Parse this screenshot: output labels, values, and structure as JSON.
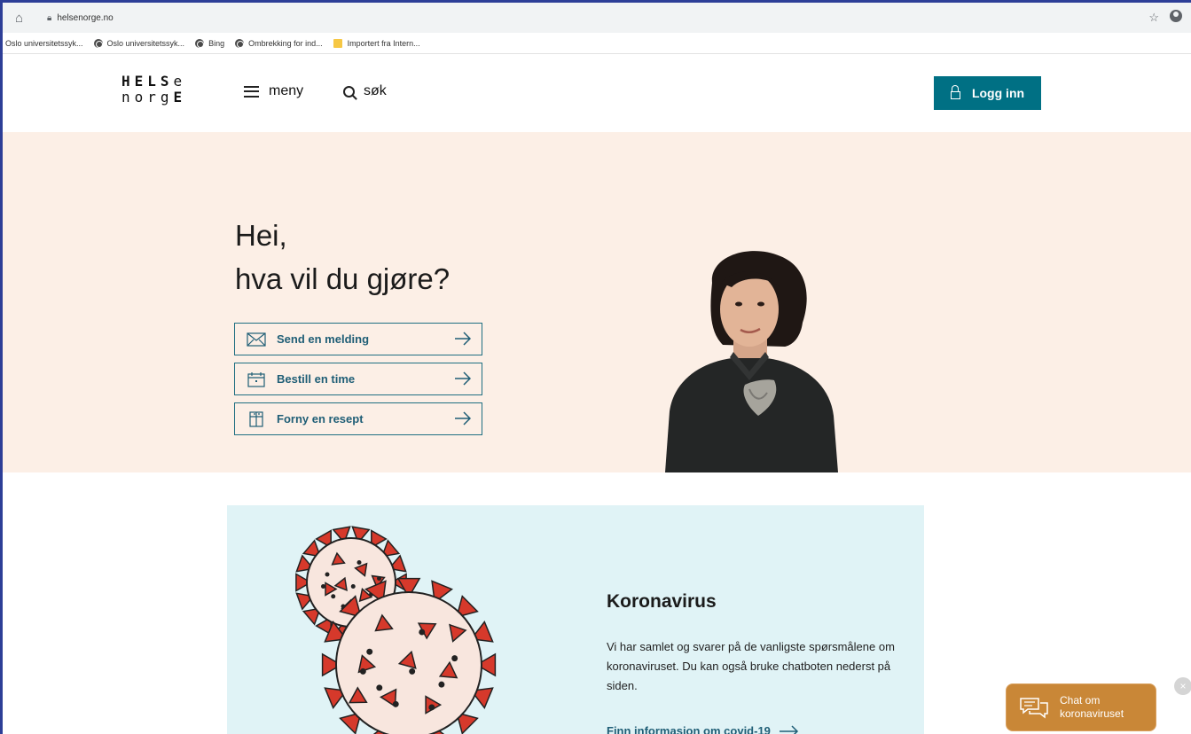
{
  "browser": {
    "url": "helsenorge.no",
    "bookmarks": [
      {
        "label": "Oslo universitetssyk...",
        "icon": "none"
      },
      {
        "label": "Oslo universitetssyk...",
        "icon": "globe-icon"
      },
      {
        "label": "Bing",
        "icon": "globe-icon"
      },
      {
        "label": "Ombrekking for ind...",
        "icon": "globe-icon"
      },
      {
        "label": "Importert fra Intern...",
        "icon": "folder-icon"
      }
    ]
  },
  "header": {
    "logo_line1_light": "HELS",
    "logo_line1_bold": "",
    "logo_line2": "norg",
    "logo_line2_end": "E",
    "logo_line1_end": "e",
    "menu_label": "meny",
    "search_label": "søk",
    "login_label": "Logg inn"
  },
  "hero": {
    "title_line1": "Hei,",
    "title_line2": "hva vil du gjøre?",
    "actions": [
      {
        "label": "Send en melding",
        "icon": "envelope-icon"
      },
      {
        "label": "Bestill en time",
        "icon": "calendar-icon"
      },
      {
        "label": "Forny en resept",
        "icon": "prescription-icon"
      }
    ]
  },
  "corona": {
    "title": "Koronavirus",
    "text": "Vi har samlet og svarer på de vanligste spørsmålene om koronaviruset. Du kan også bruke chatboten nederst på siden.",
    "link": "Finn informasjon om covid-19"
  },
  "chat": {
    "label_line1": "Chat om",
    "label_line2": "koronaviruset",
    "close": "×"
  },
  "colors": {
    "accent": "#007084",
    "hero_bg": "#fcefe6",
    "corona_bg": "#e0f3f6",
    "chat_bg": "#c98737",
    "virus_red": "#d6392b"
  }
}
